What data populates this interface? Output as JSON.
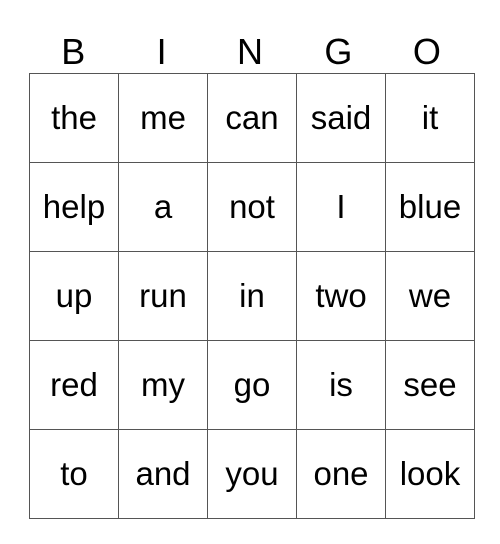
{
  "header": [
    "B",
    "I",
    "N",
    "G",
    "O"
  ],
  "rows": [
    [
      "the",
      "me",
      "can",
      "said",
      "it"
    ],
    [
      "help",
      "a",
      "not",
      "I",
      "blue"
    ],
    [
      "up",
      "run",
      "in",
      "two",
      "we"
    ],
    [
      "red",
      "my",
      "go",
      "is",
      "see"
    ],
    [
      "to",
      "and",
      "you",
      "one",
      "look"
    ]
  ]
}
